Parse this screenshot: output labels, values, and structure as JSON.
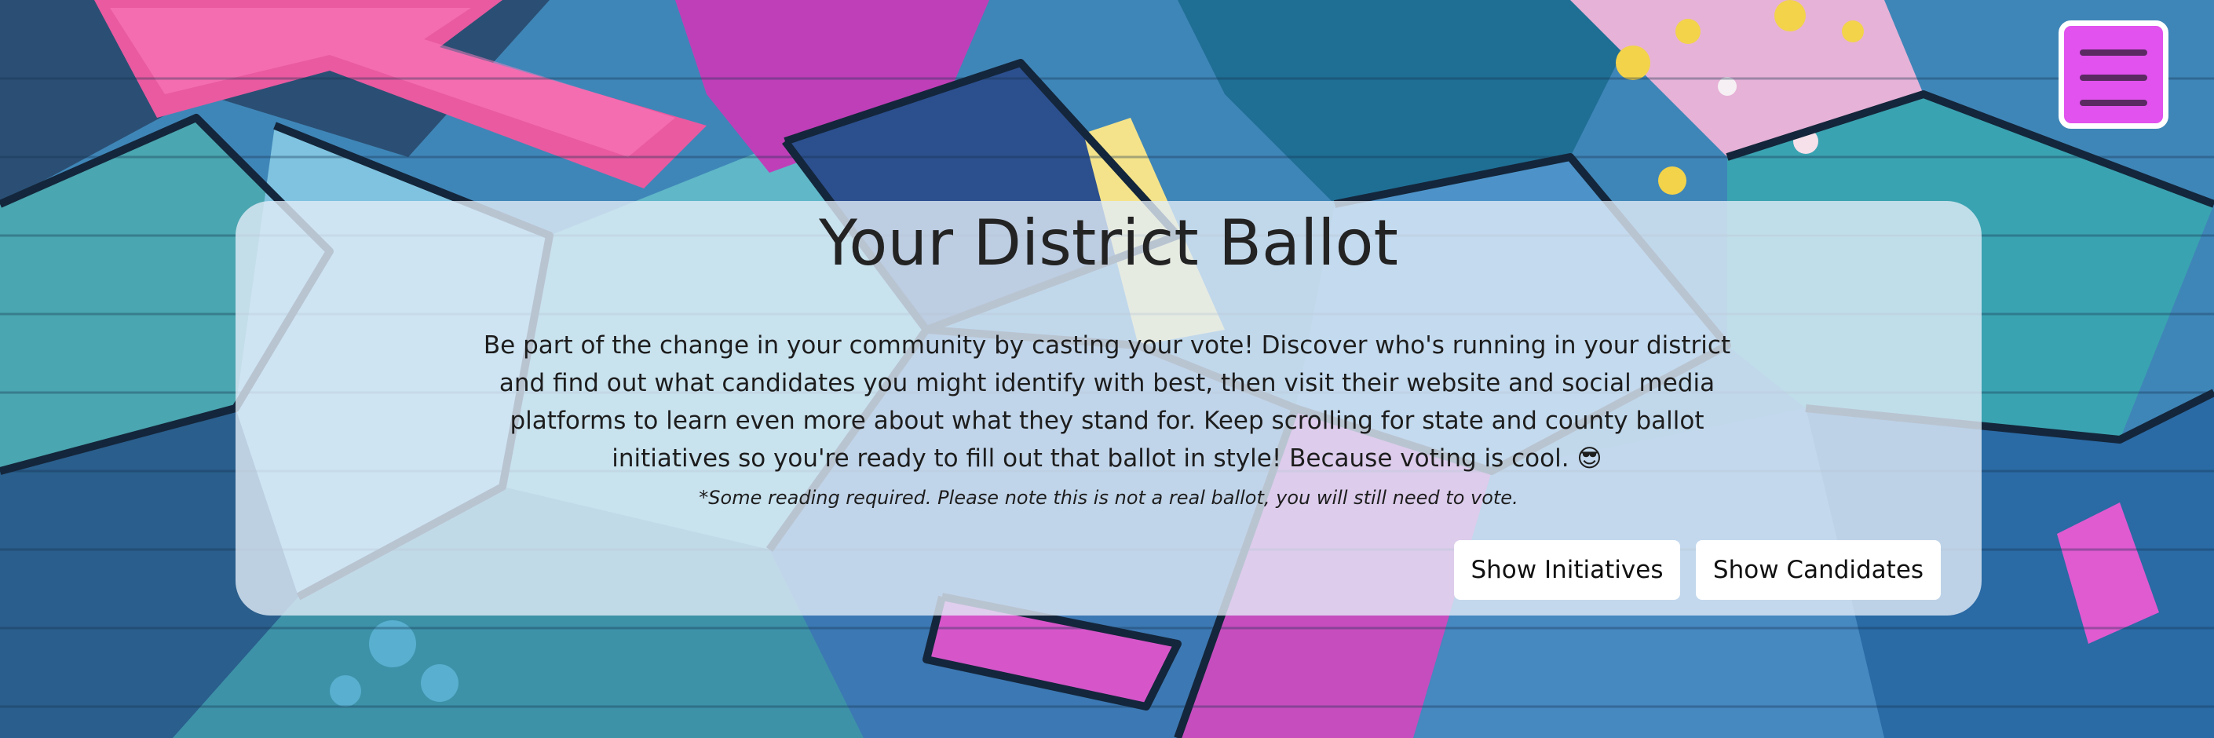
{
  "header": {
    "menu_icon": "hamburger-menu-icon"
  },
  "hero": {
    "title": "Your District Ballot",
    "description": "Be part of the change in your community by casting your vote! Discover who's running in your district and find out what candidates you might identify with best, then visit their website and social media platforms to learn even more about what they stand for. Keep scrolling for state and county ballot initiatives so you're ready to fill out that ballot in style! Because voting is cool. 😎",
    "note": "*Some reading required. Please note this is not a real ballot, you will still need to vote.",
    "buttons": {
      "initiatives_label": "Show Initiatives",
      "candidates_label": "Show Candidates"
    }
  },
  "colors": {
    "menu_accent": "#e152ee",
    "card_background": "rgba(226,236,248,0.80)",
    "title_text": "#232323"
  }
}
